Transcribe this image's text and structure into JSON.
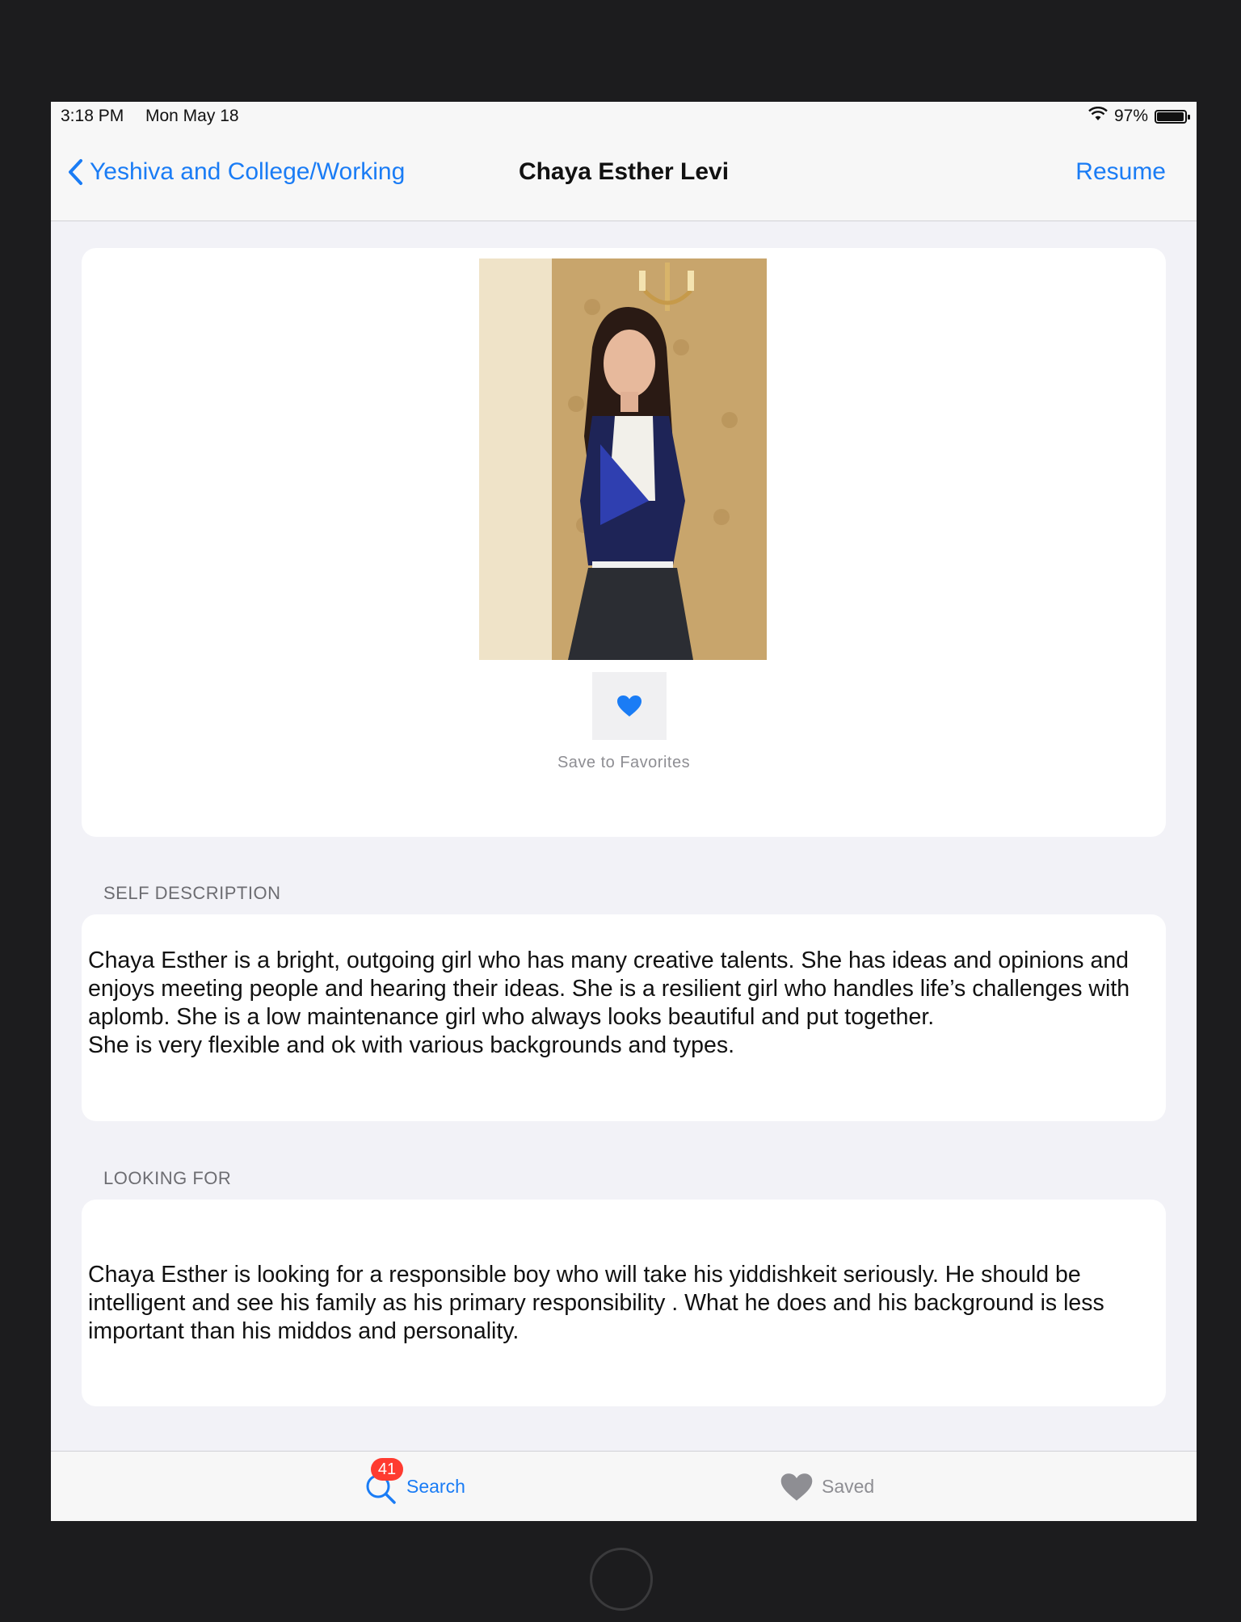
{
  "status_bar": {
    "time": "3:18 PM",
    "date": "Mon May 18",
    "wifi_icon": "wifi-icon",
    "battery_text": "97%",
    "battery_level": 0.97
  },
  "nav": {
    "back_label": "Yeshiva and College/Working",
    "title": "Chaya Esther Levi",
    "right_label": "Resume"
  },
  "profile": {
    "favorite_label": "Save to Favorites",
    "favorite_icon": "heart-icon"
  },
  "sections": {
    "self_description": {
      "header": "SELF DESCRIPTION",
      "text": "Chaya Esther is a bright, outgoing girl who has many creative  talents. She has ideas and opinions and enjoys meeting people and hearing their ideas. She is a resilient girl who handles life’s challenges with aplomb. She is a low maintenance girl who always looks beautiful and put together.\nShe is very flexible and ok with various backgrounds and types."
    },
    "looking_for": {
      "header": "LOOKING FOR",
      "text": "Chaya Esther is looking for a responsible boy who will take his yiddishkeit seriously. He should be intelligent and see his family as his primary responsibility . What he does and his background is less important than his middos and personality."
    }
  },
  "tab_bar": {
    "search_label": "Search",
    "search_badge": "41",
    "saved_label": "Saved"
  },
  "colors": {
    "accent": "#1a7cf5",
    "background": "#f2f2f7",
    "badge": "#ff3b30"
  }
}
